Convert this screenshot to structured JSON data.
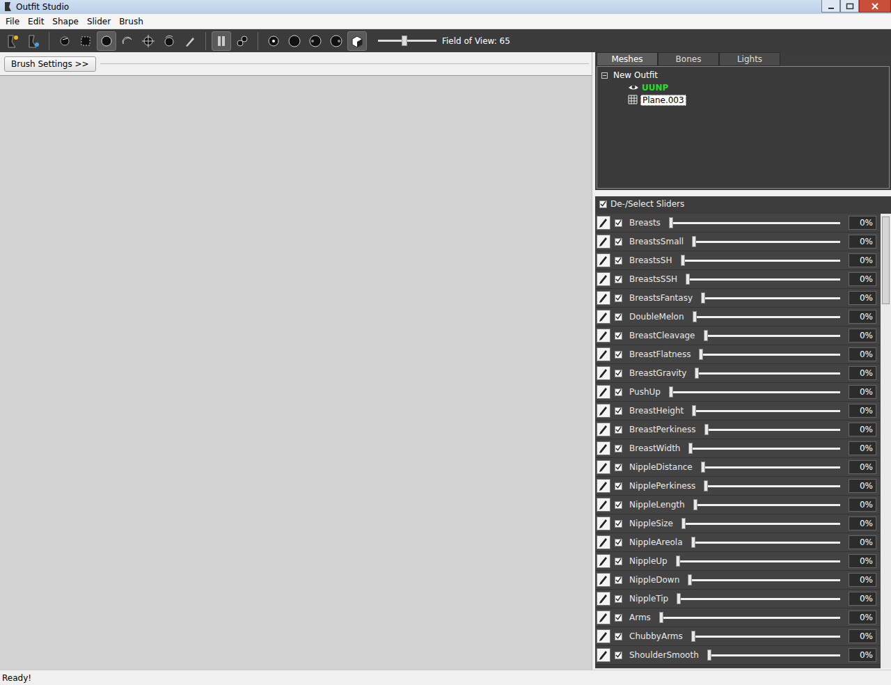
{
  "window": {
    "title": "Outfit Studio"
  },
  "menu": [
    "File",
    "Edit",
    "Shape",
    "Slider",
    "Brush"
  ],
  "toolbar": {
    "tools": [
      {
        "selected": false
      },
      {
        "selected": false
      },
      {
        "selected": false
      },
      {
        "selected": false
      },
      {
        "selected": true
      },
      {
        "selected": false
      },
      {
        "selected": false
      },
      {
        "selected": false
      },
      {
        "selected": false
      },
      {
        "selected": true
      },
      {
        "selected": false
      },
      {
        "selected": false
      },
      {
        "selected": false
      },
      {
        "selected": false
      },
      {
        "selected": false
      },
      {
        "selected": true
      }
    ],
    "fov": {
      "label": "Field of View: 65",
      "level": 0.45
    }
  },
  "brush_settings": "Brush Settings >>",
  "tabs": [
    {
      "label": "Meshes",
      "selected": true
    },
    {
      "label": "Bones",
      "selected": false
    },
    {
      "label": "Lights",
      "selected": false
    }
  ],
  "tree": {
    "root": {
      "label": "New Outfit",
      "expanded": true
    },
    "children": [
      {
        "label": "UUNP",
        "visible": true,
        "selected": false
      },
      {
        "label": "Plane.003",
        "visible": false,
        "selected": true
      }
    ]
  },
  "slider_header": {
    "label": "De-/Select Sliders",
    "checked": true
  },
  "sliders": [
    {
      "name": "Breasts",
      "checked": true,
      "level": 0,
      "value": "0%"
    },
    {
      "name": "BreastsSmall",
      "checked": true,
      "level": 0,
      "value": "0%"
    },
    {
      "name": "BreastsSH",
      "checked": true,
      "level": 0,
      "value": "0%"
    },
    {
      "name": "BreastsSSH",
      "checked": true,
      "level": 0,
      "value": "0%"
    },
    {
      "name": "BreastsFantasy",
      "checked": true,
      "level": 0,
      "value": "0%"
    },
    {
      "name": "DoubleMelon",
      "checked": true,
      "level": 0,
      "value": "0%"
    },
    {
      "name": "BreastCleavage",
      "checked": true,
      "level": 0,
      "value": "0%"
    },
    {
      "name": "BreastFlatness",
      "checked": true,
      "level": 0,
      "value": "0%"
    },
    {
      "name": "BreastGravity",
      "checked": true,
      "level": 0,
      "value": "0%"
    },
    {
      "name": "PushUp",
      "checked": true,
      "level": 0,
      "value": "0%"
    },
    {
      "name": "BreastHeight",
      "checked": true,
      "level": 0,
      "value": "0%"
    },
    {
      "name": "BreastPerkiness",
      "checked": true,
      "level": 0,
      "value": "0%"
    },
    {
      "name": "BreastWidth",
      "checked": true,
      "level": 0,
      "value": "0%"
    },
    {
      "name": "NippleDistance",
      "checked": true,
      "level": 0,
      "value": "0%"
    },
    {
      "name": "NipplePerkiness",
      "checked": true,
      "level": 0,
      "value": "0%"
    },
    {
      "name": "NippleLength",
      "checked": true,
      "level": 0,
      "value": "0%"
    },
    {
      "name": "NippleSize",
      "checked": true,
      "level": 0,
      "value": "0%"
    },
    {
      "name": "NippleAreola",
      "checked": true,
      "level": 0,
      "value": "0%"
    },
    {
      "name": "NippleUp",
      "checked": true,
      "level": 0,
      "value": "0%"
    },
    {
      "name": "NippleDown",
      "checked": true,
      "level": 0,
      "value": "0%"
    },
    {
      "name": "NippleTip",
      "checked": true,
      "level": 0,
      "value": "0%"
    },
    {
      "name": "Arms",
      "checked": true,
      "level": 0,
      "value": "0%"
    },
    {
      "name": "ChubbyArms",
      "checked": true,
      "level": 0,
      "value": "0%"
    },
    {
      "name": "ShoulderSmooth",
      "checked": true,
      "level": 0,
      "value": "0%"
    }
  ],
  "status_bar": "Ready!"
}
